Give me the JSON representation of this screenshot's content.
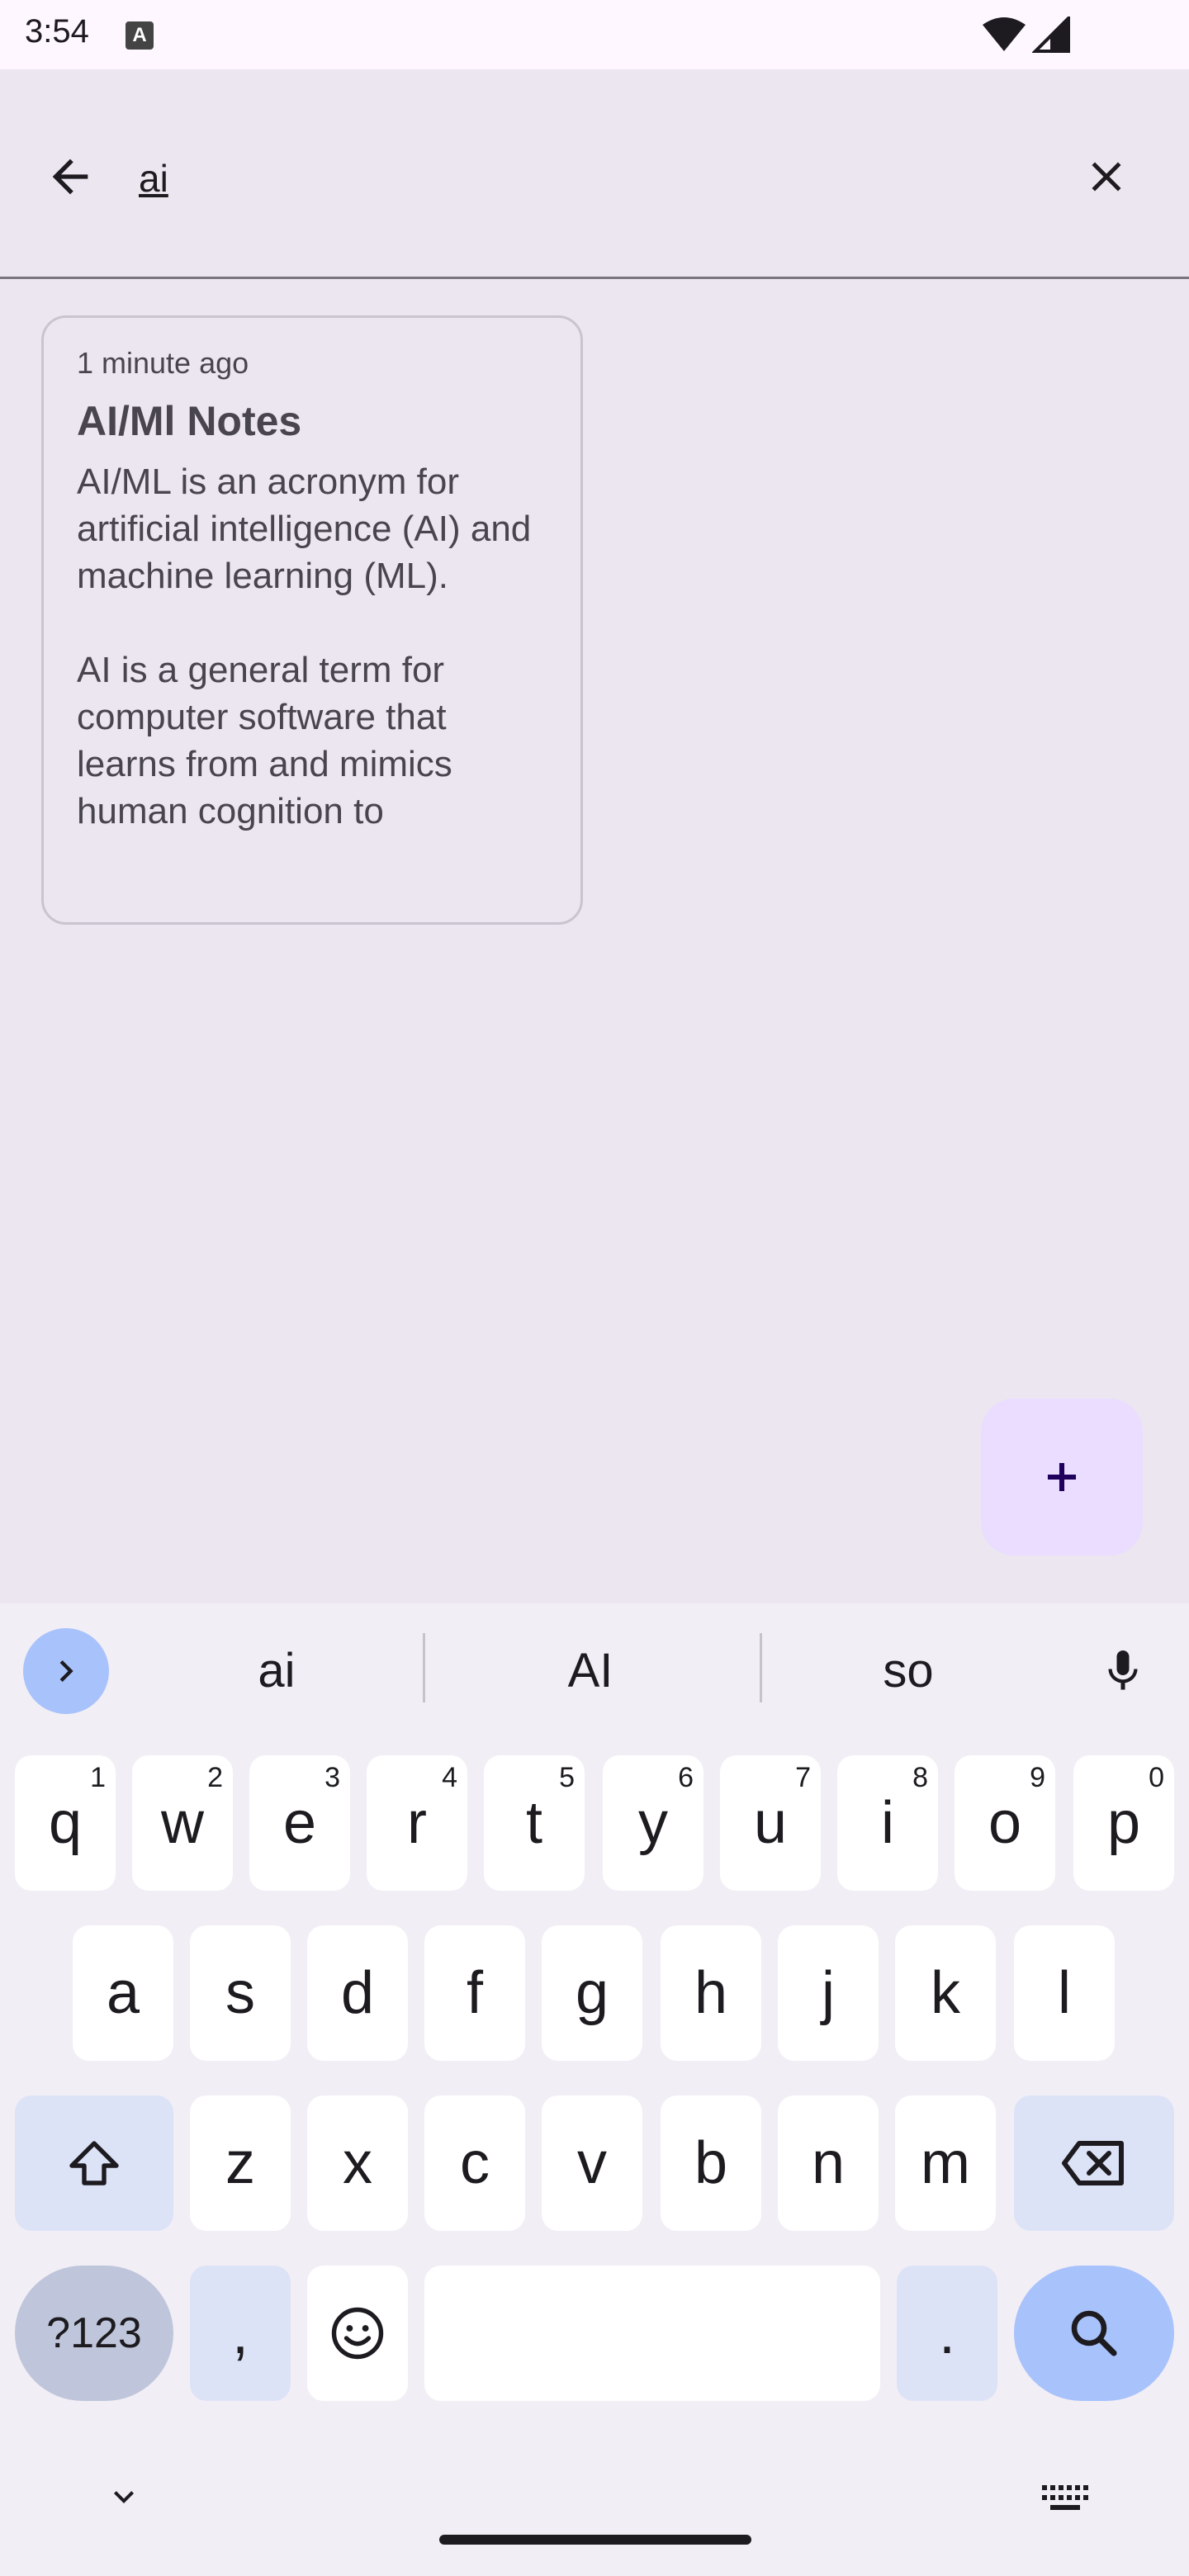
{
  "status": {
    "time": "3:54",
    "notification_icon": "A"
  },
  "search": {
    "query": "ai"
  },
  "results": [
    {
      "time": "1 minute ago",
      "title": "AI/Ml Notes",
      "body": "AI/ML is an acronym for artificial intelligence (AI) and machine learning (ML).\n\nAI is a general term for computer software that learns from and mimics human cognition to"
    }
  ],
  "keyboard": {
    "suggestions": [
      "ai",
      "AI",
      "so"
    ],
    "row1": [
      {
        "key": "q",
        "hint": "1"
      },
      {
        "key": "w",
        "hint": "2"
      },
      {
        "key": "e",
        "hint": "3"
      },
      {
        "key": "r",
        "hint": "4"
      },
      {
        "key": "t",
        "hint": "5"
      },
      {
        "key": "y",
        "hint": "6"
      },
      {
        "key": "u",
        "hint": "7"
      },
      {
        "key": "i",
        "hint": "8"
      },
      {
        "key": "o",
        "hint": "9"
      },
      {
        "key": "p",
        "hint": "0"
      }
    ],
    "row2": [
      "a",
      "s",
      "d",
      "f",
      "g",
      "h",
      "j",
      "k",
      "l"
    ],
    "row3": [
      "z",
      "x",
      "c",
      "v",
      "b",
      "n",
      "m"
    ],
    "symbols_label": "?123",
    "comma": ",",
    "period": "."
  },
  "colors": {
    "accent": "#A8C2FB",
    "fab": "#EADDFF",
    "background": "#ECE6F0"
  }
}
